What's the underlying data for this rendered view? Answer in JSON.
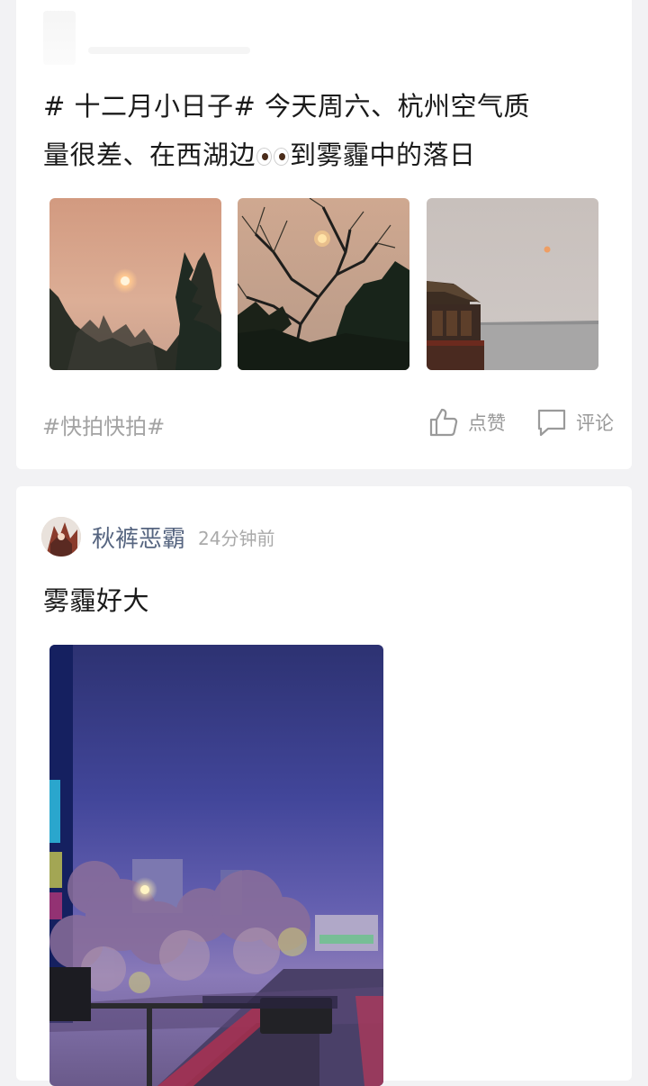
{
  "posts": [
    {
      "text_line1": "# 十二月小日子# 今天周六、杭州空气质",
      "text_line2_a": "量很差、在西湖边",
      "text_line2_b": "到雾霾中的落日",
      "images": [
        "sunset-trees-photo",
        "sunset-branches-photo",
        "lake-pavilion-photo"
      ],
      "tag": "#快拍快拍#",
      "like_label": "点赞",
      "comment_label": "评论"
    },
    {
      "author": "秋裤恶霸",
      "time": "24分钟前",
      "text": "雾霾好大",
      "images": [
        "night-street-smog-photo"
      ]
    }
  ],
  "colors": {
    "background": "#f2f2f4",
    "card": "#ffffff",
    "author_name": "#566580",
    "muted": "#a3a3a3"
  },
  "icons": [
    "thumbs-up-icon",
    "comment-icon"
  ]
}
